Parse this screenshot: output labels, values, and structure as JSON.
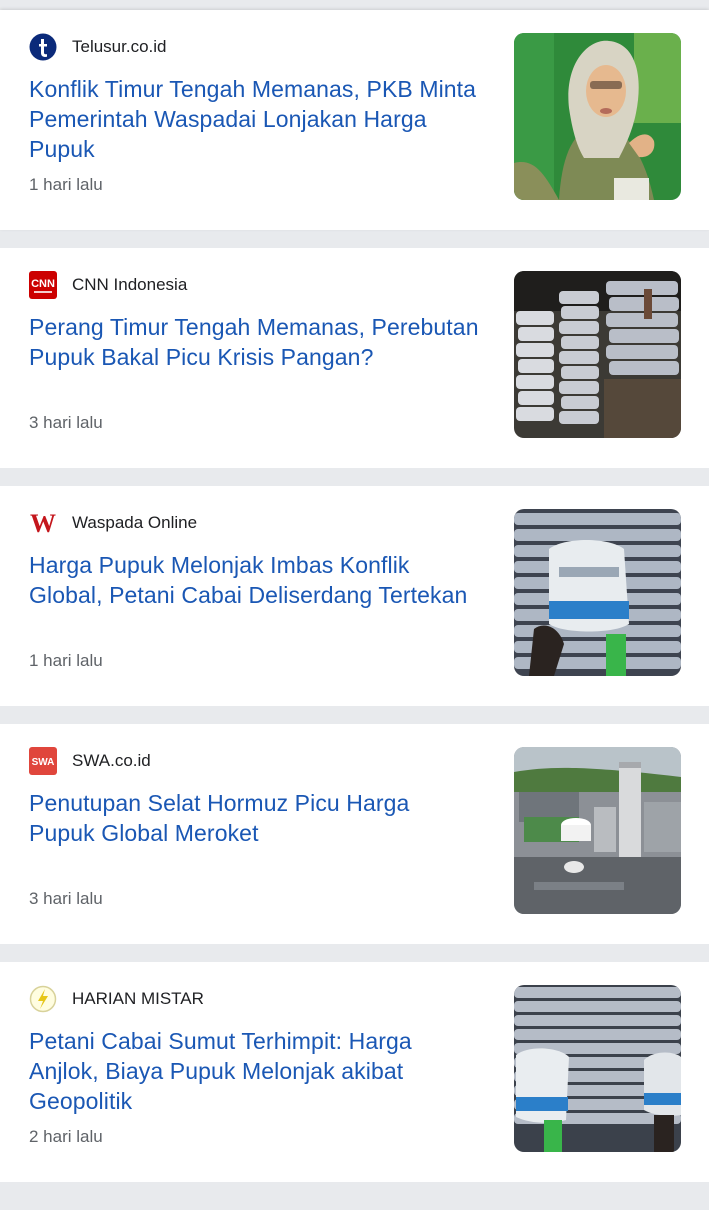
{
  "feed": {
    "articles": [
      {
        "source": "Telusur.co.id",
        "title": "Konflik Timur Tengah Memanas, PKB Minta Pemerintah Waspadai Lonjakan Harga Pupuk",
        "time": "1 hari lalu",
        "logo_icon": "telusur-logo-icon",
        "image": "woman-in-hijab-speaking-photo"
      },
      {
        "source": "CNN Indonesia",
        "title": "Perang Timur Tengah Memanas, Perebutan Pupuk Bakal Picu Krisis Pangan?",
        "time": "3 hari lalu",
        "logo_icon": "cnn-logo-icon",
        "logo_text": "CNN",
        "image": "fertilizer-sacks-warehouse-photo"
      },
      {
        "source": "Waspada Online",
        "title": "Harga Pupuk Melonjak Imbas Konflik Global, Petani Cabai Deliserdang Tertekan",
        "time": "1 hari lalu",
        "logo_icon": "waspada-logo-icon",
        "logo_text": "W",
        "image": "worker-carrying-sack-photo"
      },
      {
        "source": "SWA.co.id",
        "title": "Penutupan Selat Hormuz Picu Harga Pupuk Global Meroket",
        "time": "3 hari lalu",
        "logo_icon": "swa-logo-icon",
        "logo_text": "SWA",
        "image": "fertilizer-factory-aerial-photo"
      },
      {
        "source": "HARIAN MISTAR",
        "title": "Petani Cabai Sumut Terhimpit: Harga Anjlok, Biaya Pupuk Melonjak akibat Geopolitik",
        "time": "2 hari lalu",
        "logo_icon": "harian-mistar-logo-icon",
        "image": "workers-carrying-sacks-photo"
      }
    ]
  },
  "colors": {
    "headline": "#1a57b4",
    "source": "#202124",
    "time": "#5f6368",
    "separator": "#e8eaed",
    "telusur_brand": "#0b2a7a",
    "cnn_brand": "#cc0000",
    "waspada_brand": "#c4161c",
    "swa_brand": "#e0463c"
  }
}
